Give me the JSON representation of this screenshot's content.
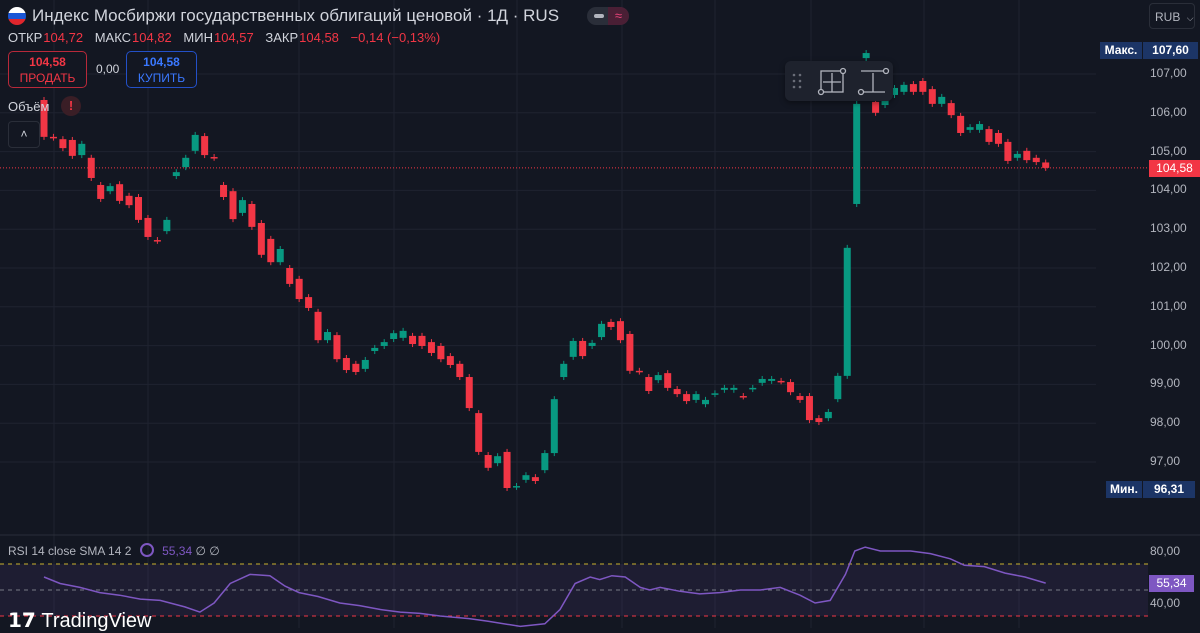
{
  "header": {
    "title": "Индекс Мосбиржи государственных облигаций ценовой · 1Д · RUS",
    "ohlc": [
      {
        "key": "ОТКР",
        "value": "104,72"
      },
      {
        "key": "МАКС",
        "value": "104,82"
      },
      {
        "key": "МИН",
        "value": "104,57"
      },
      {
        "key": "ЗАКР",
        "value": "104,58"
      }
    ],
    "change": "−0,14 (−0,13%)",
    "sell": {
      "price": "104,58",
      "label": "ПРОДАТЬ"
    },
    "spread": "0,00",
    "buy": {
      "price": "104,58",
      "label": "КУПИТЬ"
    },
    "volume_label": "Объём",
    "warning": "!",
    "currency": "RUB"
  },
  "colors": {
    "up": "#089981",
    "down": "#f23645",
    "bg": "#131722",
    "grid": "#1f2330",
    "rsi": "#7e57c2",
    "badge": "#1c3566"
  },
  "chart_data": [
    {
      "type": "candlestick",
      "title": "Индекс Мосбиржи государственных облигаций ценовой",
      "interval": "1Д",
      "ylim": [
        95.7,
        108.0
      ],
      "yticks": [
        "107,00",
        "106,00",
        "105,00",
        "104,00",
        "103,00",
        "102,00",
        "101,00",
        "100,00",
        "99,00",
        "98,00",
        "97,00"
      ],
      "ytick_values": [
        107,
        106,
        105,
        104,
        103,
        102,
        101,
        100,
        99,
        98,
        97
      ],
      "max_label": "Макс.",
      "max_value": "107,60",
      "min_label": "Мин.",
      "min_value": "96,31",
      "last_price": "104,58",
      "last_value": 104.58,
      "candles_open_close": [
        [
          106.33,
          105.38
        ],
        [
          105.38,
          105.36
        ],
        [
          105.32,
          105.09
        ],
        [
          105.3,
          104.89
        ],
        [
          104.91,
          105.2
        ],
        [
          104.84,
          104.32
        ],
        [
          104.14,
          103.78
        ],
        [
          103.98,
          104.11
        ],
        [
          104.16,
          103.73
        ],
        [
          103.86,
          103.62
        ],
        [
          103.83,
          103.24
        ],
        [
          103.29,
          102.8
        ],
        [
          102.72,
          102.7
        ],
        [
          102.95,
          103.24
        ],
        [
          104.37,
          104.47
        ],
        [
          104.6,
          104.84
        ],
        [
          105.02,
          105.43
        ],
        [
          105.4,
          104.91
        ],
        [
          104.86,
          104.84
        ],
        [
          104.14,
          103.83
        ],
        [
          103.98,
          103.26
        ],
        [
          103.42,
          103.75
        ],
        [
          103.65,
          103.06
        ],
        [
          103.16,
          102.34
        ],
        [
          102.75,
          102.15
        ],
        [
          102.15,
          102.49
        ],
        [
          102.0,
          101.59
        ],
        [
          101.72,
          101.2
        ],
        [
          101.25,
          100.97
        ],
        [
          100.87,
          100.14
        ],
        [
          100.14,
          100.35
        ],
        [
          100.27,
          99.65
        ],
        [
          99.68,
          99.37
        ],
        [
          99.53,
          99.32
        ],
        [
          99.4,
          99.63
        ],
        [
          99.86,
          99.94
        ],
        [
          99.99,
          100.09
        ],
        [
          100.17,
          100.32
        ],
        [
          100.2,
          100.38
        ],
        [
          100.25,
          100.04
        ],
        [
          100.25,
          99.99
        ],
        [
          100.09,
          99.81
        ],
        [
          99.99,
          99.65
        ],
        [
          99.73,
          99.5
        ],
        [
          99.53,
          99.19
        ],
        [
          99.19,
          98.39
        ],
        [
          98.26,
          97.26
        ],
        [
          97.18,
          96.85
        ],
        [
          96.97,
          97.15
        ],
        [
          97.26,
          96.33
        ],
        [
          96.36,
          96.38
        ],
        [
          96.54,
          96.66
        ],
        [
          96.61,
          96.51
        ],
        [
          96.79,
          97.23
        ],
        [
          97.23,
          98.62
        ],
        [
          99.19,
          99.53
        ],
        [
          99.71,
          100.12
        ],
        [
          100.12,
          99.73
        ],
        [
          99.99,
          100.07
        ],
        [
          100.22,
          100.56
        ],
        [
          100.61,
          100.48
        ],
        [
          100.63,
          100.14
        ],
        [
          100.3,
          99.35
        ],
        [
          99.35,
          99.33
        ],
        [
          99.19,
          98.83
        ],
        [
          99.11,
          99.24
        ],
        [
          99.29,
          98.91
        ],
        [
          98.88,
          98.75
        ],
        [
          98.75,
          98.57
        ],
        [
          98.6,
          98.75
        ],
        [
          98.49,
          98.6
        ],
        [
          98.75,
          98.77
        ],
        [
          98.86,
          98.91
        ],
        [
          98.86,
          98.91
        ],
        [
          98.7,
          98.69
        ],
        [
          98.88,
          98.91
        ],
        [
          99.04,
          99.14
        ],
        [
          99.09,
          99.14
        ],
        [
          99.09,
          99.08
        ],
        [
          99.06,
          98.8
        ],
        [
          98.7,
          98.6
        ],
        [
          98.7,
          98.08
        ],
        [
          98.13,
          98.03
        ],
        [
          98.13,
          98.29
        ],
        [
          98.62,
          99.22
        ],
        [
          99.22,
          102.52
        ],
        [
          103.65,
          106.23
        ],
        [
          107.41,
          107.54
        ],
        [
          106.28,
          106.0
        ],
        [
          106.2,
          106.46
        ],
        [
          106.46,
          106.64
        ],
        [
          106.54,
          106.72
        ],
        [
          106.74,
          106.54
        ],
        [
          106.82,
          106.54
        ],
        [
          106.61,
          106.23
        ],
        [
          106.23,
          106.41
        ],
        [
          106.25,
          105.94
        ],
        [
          105.92,
          105.48
        ],
        [
          105.56,
          105.63
        ],
        [
          105.56,
          105.71
        ],
        [
          105.58,
          105.25
        ],
        [
          105.48,
          105.2
        ],
        [
          105.25,
          104.76
        ],
        [
          104.84,
          104.94
        ],
        [
          105.02,
          104.78
        ],
        [
          104.84,
          104.73
        ],
        [
          104.72,
          104.58
        ]
      ]
    },
    {
      "type": "line",
      "title": "RSI 14 close SMA 14 2",
      "legend_value": "55,34",
      "legend_extra": "∅ ∅",
      "ylim": [
        20,
        90
      ],
      "yticks": [
        "80,00",
        "40,00"
      ],
      "ytick_values": [
        80,
        40
      ],
      "bands": {
        "upper": 70,
        "middle": 50,
        "lower": 30
      },
      "last_value_label": "55,34",
      "points_candle_index_value": [
        [
          0,
          60
        ],
        [
          1.7,
          55
        ],
        [
          3.8,
          52
        ],
        [
          5.9,
          48
        ],
        [
          8,
          46
        ],
        [
          10.2,
          43
        ],
        [
          12.3,
          42
        ],
        [
          14.9,
          37
        ],
        [
          16.5,
          33
        ],
        [
          18,
          40
        ],
        [
          19.7,
          55
        ],
        [
          21.8,
          62
        ],
        [
          23.9,
          61
        ],
        [
          25.5,
          53
        ],
        [
          27,
          48
        ],
        [
          29,
          45
        ],
        [
          31.3,
          40
        ],
        [
          33.4,
          38
        ],
        [
          35.6,
          35
        ],
        [
          37.7,
          33
        ],
        [
          39.8,
          32
        ],
        [
          41.9,
          30
        ],
        [
          45,
          28
        ],
        [
          47,
          26
        ],
        [
          50.4,
          22
        ],
        [
          53,
          24
        ],
        [
          54.6,
          35
        ],
        [
          56.2,
          55
        ],
        [
          57.8,
          60
        ],
        [
          58.8,
          58
        ],
        [
          60.1,
          61
        ],
        [
          61.5,
          60
        ],
        [
          63.1,
          52
        ],
        [
          64.1,
          50
        ],
        [
          65.2,
          52
        ],
        [
          67.3,
          49
        ],
        [
          69.4,
          47
        ],
        [
          71.5,
          48
        ],
        [
          73.7,
          50
        ],
        [
          75.8,
          50
        ],
        [
          77.9,
          52
        ],
        [
          80,
          46
        ],
        [
          81.6,
          40
        ],
        [
          83.2,
          42
        ],
        [
          84.8,
          62
        ],
        [
          85.8,
          80
        ],
        [
          86.9,
          83
        ],
        [
          88.5,
          80
        ],
        [
          91.7,
          80
        ],
        [
          93.8,
          78
        ],
        [
          95.9,
          74
        ],
        [
          97.4,
          69
        ],
        [
          99.5,
          68
        ],
        [
          101.7,
          63
        ],
        [
          103.8,
          60
        ],
        [
          106,
          55.34
        ]
      ]
    }
  ],
  "branding": "TradingView"
}
